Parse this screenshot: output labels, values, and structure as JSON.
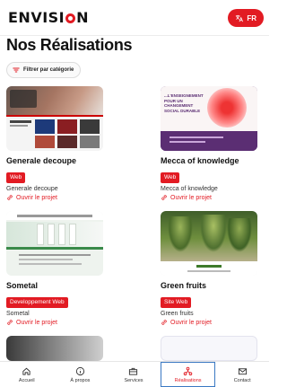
{
  "app": {
    "logo_text_left": "ENVISI",
    "logo_text_right": "N",
    "lang_label": "FR"
  },
  "page": {
    "title": "Nos Réalisations",
    "filter_label": "Filtrer par catégorie"
  },
  "projects": [
    {
      "title": "Generale decoupe",
      "tag": "Web",
      "subtitle": "Generale decoupe",
      "link": "Ouvrir le projet"
    },
    {
      "title": "Mecca of knowledge",
      "tag": "Web",
      "subtitle": "Mecca of knowledge",
      "link": "Ouvrir le projet",
      "thumb_text": "...L'ENSEIGNEMENT POUR UN CHANGEMENT SOCIAL DURABLE"
    },
    {
      "title": "Sometal",
      "tag": "Developpement Web",
      "subtitle": "Sometal",
      "link": "Ouvrir le projet"
    },
    {
      "title": "Green fruits",
      "tag": "Site Web",
      "subtitle": "Green fruits",
      "link": "Ouvrir le projet"
    }
  ],
  "nav": [
    {
      "label": "Accueil",
      "icon": "home-icon"
    },
    {
      "label": "À propos",
      "icon": "info-icon"
    },
    {
      "label": "Services",
      "icon": "briefcase-icon"
    },
    {
      "label": "Réalisations",
      "icon": "network-icon",
      "active": true
    },
    {
      "label": "Contact",
      "icon": "mail-icon"
    }
  ],
  "colors": {
    "accent": "#e21b23",
    "active_outline": "#3a78c3"
  }
}
